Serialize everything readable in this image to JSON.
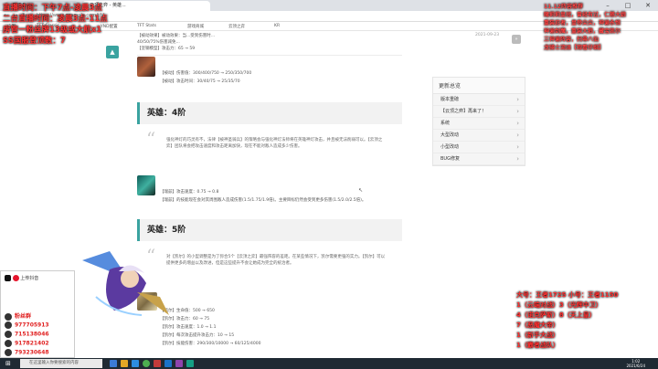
{
  "browser": {
    "tabs": [
      "TFT Data...",
      "云顶之弈 - 英雄..."
    ],
    "url": "https://www.example.com/tft/",
    "bookmarks": [
      "应用",
      "TFT Classic",
      "YND配置",
      "TFT Stats",
      "游戏商城",
      "云顶之弈",
      "KR"
    ]
  },
  "article": {
    "top_lines": [
      "【被动效果】被动效果：当...受到伤害时...",
      "40/50/75%伤害减免...",
      "【坚钢模型】攻击力：65 → 59"
    ],
    "date": "2021-09-23",
    "hero1": {
      "line1": "【被动】伤害值：300/400/750 → 250/350/700",
      "line2": "【被动】攻击时间：30/40/75 → 25/35/70"
    },
    "tier4_heading": "英雄：4阶",
    "tier4_quote": "强化神灯的巧灵有不，法律【被神圣骑兵】的策略会与强化神灯法师将在英雄神灯攻击，并且被无法削弱可以。【云顶之弈】团队将会把攻击速度和攻击距离加快，现在不能对敌人造成多少伤害。",
    "tier4_hero": {
      "line1": "【瑞兹】攻击速度：0.75 → 0.8",
      "line2": "【瑞兹】的技能现在会对其周围敌人造成伤害(1.5/1.75/1.9倍)。主要目标仍然会受到更多伤害(1.5/2.0/2.5倍)。"
    },
    "tier5_heading": "英雄：5阶",
    "tier5_quote": "对【凯尔】的小型调整是为了弥合5个【云顶之弈】最强阵容的差距。在某些情况下，凯尔需要更强的实力。【凯尔】可以提供更多的增益以及改进，但是这些提升不会让她成为完全的统治者。",
    "tier5_hero": {
      "lines": [
        "【凯尔】生命值：500 → 650",
        "【凯尔】攻击力：60 → 75",
        "【凯尔】攻击速度：1.0 → 1.1",
        "【凯尔】每次攻击提升攻击力：10 → 15",
        "【凯尔】技能伤害：290/300/10000 → 60/125/4000"
      ]
    }
  },
  "sidebar": {
    "title": "更新总览",
    "items": [
      "版本重磅",
      "【云顶之弈】再来了！",
      "系统",
      "大型改动",
      "小型改动",
      "BUG修复"
    ]
  },
  "overlay": {
    "left_lines": [
      "直播时间：下午7点-凌晨3点",
      "二台直播时间：凌晨3点-11点",
      "房管一粉丝牌13级或大航x1",
      "SS国服登顶数：7"
    ],
    "right_lines": [
      "11.12阵容推荐",
      "赌莉莉皇冠，曾经有过，仁慈大娘",
      "重装忍者，皇帝尖尖，神谕永恒",
      "神谕剑魔，重装大狼，藏宝凯尔",
      "三神谕阵容，扫帚八仙",
      "龙骑士流派【观看仔细】"
    ],
    "bottom_right_lines": [
      "大号：王者1725 小号：王者1150",
      "1（云端对战）3（光辉中卫）",
      "4（诺克萨斯）8（天上皇）",
      "7（恶魔大帝）",
      "1（新手大战）",
      "1（霸者战队）"
    ],
    "qq_lines": [
      "977705913",
      "715138046",
      "917821402",
      "793230648"
    ],
    "qq_label": "粉丝群",
    "social_label": "上传抖音"
  },
  "taskbar": {
    "search_placeholder": "在这里输入你要搜索的内容",
    "time": "1:02",
    "date": "2021/6/24"
  },
  "colors": {
    "accent": "#3aa3a0",
    "overlay_red": "#ff3333"
  }
}
